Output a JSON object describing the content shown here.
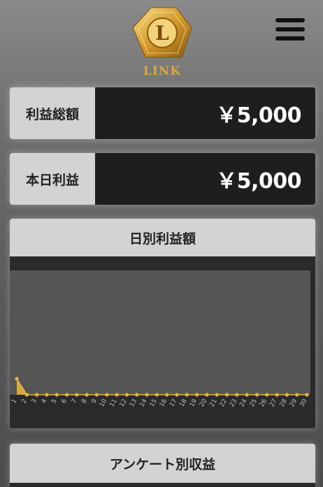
{
  "header": {
    "logo_letter": "L",
    "logo_text": "LINK",
    "menu_icon": "hamburger-menu-icon"
  },
  "stats": {
    "total_profit": {
      "label": "利益総額",
      "value": "￥5,000"
    },
    "today_profit": {
      "label": "本日利益",
      "value": "￥5,000"
    }
  },
  "daily_chart": {
    "title": "日別利益額"
  },
  "survey": {
    "title": "アンケート別収益"
  },
  "colors": {
    "accent_gold": "#e2b43c",
    "panel_dark": "#1e1e1e",
    "panel_light": "#d3d3d3"
  },
  "chart_data": {
    "type": "area",
    "x": [
      "1",
      "2",
      "3",
      "4",
      "5",
      "6",
      "7",
      "8",
      "9",
      "10",
      "11",
      "12",
      "13",
      "14",
      "15",
      "16",
      "17",
      "18",
      "19",
      "20",
      "21",
      "22",
      "23",
      "24",
      "25",
      "26",
      "27",
      "28",
      "29",
      "30"
    ],
    "series": [
      {
        "values": [
          5000,
          0,
          0,
          0,
          0,
          0,
          0,
          0,
          0,
          0,
          0,
          0,
          0,
          0,
          0,
          0,
          0,
          0,
          0,
          0,
          0,
          0,
          0,
          0,
          0,
          0,
          0,
          0,
          0,
          0
        ]
      }
    ],
    "xlabel": "",
    "ylabel": "",
    "ylim": [
      0,
      5000
    ],
    "grid": false
  }
}
